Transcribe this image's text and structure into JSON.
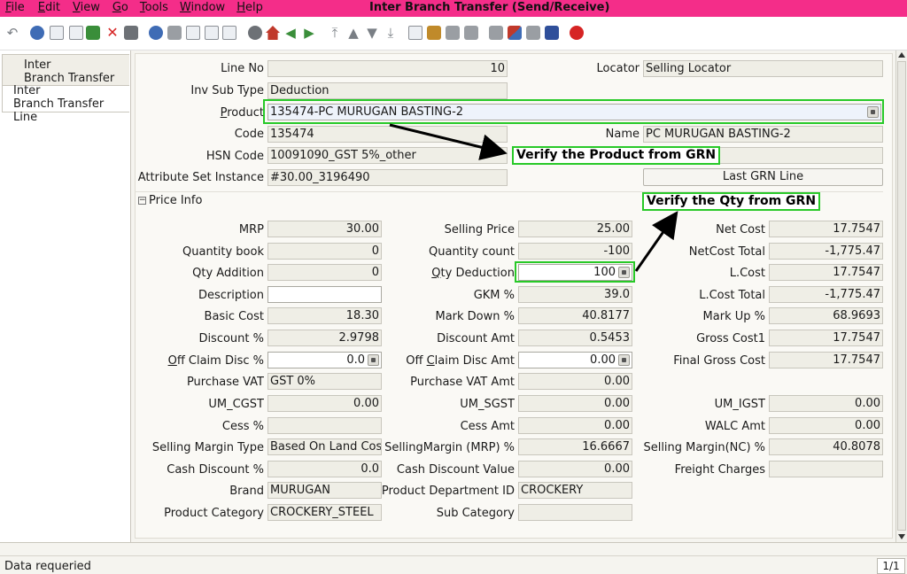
{
  "window": {
    "title": "Inter Branch Transfer (Send/Receive)"
  },
  "menu": [
    {
      "u": "F",
      "rest": "ile"
    },
    {
      "u": "E",
      "rest": "dit"
    },
    {
      "u": "V",
      "rest": "iew"
    },
    {
      "u": "G",
      "rest": "o"
    },
    {
      "u": "T",
      "rest": "ools"
    },
    {
      "u": "W",
      "rest": "indow"
    },
    {
      "u": "H",
      "rest": "elp"
    }
  ],
  "nav": {
    "tab_header": "Inter\nBranch Transfer",
    "tab_header_l1": "Inter",
    "tab_header_l2": "Branch Transfer",
    "tab_line_l1": "Inter",
    "tab_line_l2": "Branch Transfer Line"
  },
  "form": {
    "line_no_label": "Line No",
    "line_no": "10",
    "locator_label": "Locator",
    "locator": "Selling Locator",
    "inv_sub_type_label": "Inv Sub Type",
    "inv_sub_type": "Deduction",
    "product_label_u": "P",
    "product_label_rest": "roduct",
    "product": "135474-PC MURUGAN BASTING-2",
    "code_label": "Code",
    "code": "135474",
    "name_label": "Name",
    "name": "PC MURUGAN BASTING-2",
    "hsn_label": "HSN Code",
    "hsn": "10091090_GST 5%_other",
    "attr_label": "Attribute Set Instance",
    "attr": "#30.00_3196490",
    "last_grn_button": "Last GRN Line",
    "section_price": "Price Info"
  },
  "annotations": {
    "verify_product": "Verify the Product from GRN",
    "verify_qty": "Verify the Qty from GRN"
  },
  "price": {
    "mrp_label": "MRP",
    "mrp": "30.00",
    "selling_price_label": "Selling Price",
    "selling_price": "25.00",
    "net_cost_label": "Net Cost",
    "net_cost": "17.7547",
    "qty_book_label": "Quantity book",
    "qty_book": "0",
    "qty_count_label": "Quantity count",
    "qty_count": "-100",
    "netcost_total_label": "NetCost Total",
    "netcost_total": "-1,775.47",
    "qty_add_label": "Qty Addition",
    "qty_add": "0",
    "qty_ded_label_u": "Q",
    "qty_ded_label_rest": "ty Deduction",
    "qty_ded": "100",
    "lcost_label": "L.Cost",
    "lcost": "17.7547",
    "desc_label": "Description",
    "desc": "",
    "gkm_label": "GKM %",
    "gkm": "39.0",
    "lcost_total_label": "L.Cost Total",
    "lcost_total": "-1,775.47",
    "basic_cost_label": "Basic Cost",
    "basic_cost": "18.30",
    "markdown_label": "Mark Down %",
    "markdown": "40.8177",
    "markup_label": "Mark Up %",
    "markup": "68.9693",
    "discount_label": "Discount %",
    "discount": "2.9798",
    "discount_amt_label": "Discount Amt",
    "discount_amt": "0.5453",
    "gross_cost1_label": "Gross Cost1",
    "gross_cost1": "17.7547",
    "off_claim_pct_label_u": "O",
    "off_claim_pct_label_rest": "ff Claim Disc %",
    "off_claim_pct": "0.0",
    "off_claim_amt_label_a": "Off ",
    "off_claim_amt_label_u": "C",
    "off_claim_amt_label_rest": "laim Disc Amt",
    "off_claim_amt": "0.00",
    "final_gross_label": "Final Gross Cost",
    "final_gross": "17.7547",
    "purchase_vat_label": "Purchase VAT",
    "purchase_vat": "GST 0%",
    "purchase_vat_amt_label": "Purchase VAT Amt",
    "purchase_vat_amt": "0.00",
    "um_cgst_label": "UM_CGST",
    "um_cgst": "0.00",
    "um_sgst_label": "UM_SGST",
    "um_sgst": "0.00",
    "um_igst_label": "UM_IGST",
    "um_igst": "0.00",
    "cess_pct_label": "Cess %",
    "cess_pct": "",
    "cess_amt_label": "Cess Amt",
    "cess_amt": "0.00",
    "walc_amt_label": "WALC Amt",
    "walc_amt": "0.00",
    "sm_type_label": "Selling Margin Type",
    "sm_type": "Based On Land Cost",
    "sm_mrp_label": "SellingMargin (MRP) %",
    "sm_mrp": "16.6667",
    "sm_nc_label": "Selling Margin(NC) %",
    "sm_nc": "40.8078",
    "cash_disc_label": "Cash Discount %",
    "cash_disc": "0.0",
    "cash_disc_val_label": "Cash Discount Value",
    "cash_disc_val": "0.00",
    "freight_label": "Freight Charges",
    "freight": "",
    "brand_label": "Brand",
    "brand": "MURUGAN",
    "dept_label": "Product Department ID",
    "dept": "CROCKERY",
    "category_label": "Product Category",
    "category": "CROCKERY_STEEL",
    "subcat_label": "Sub Category",
    "subcat": ""
  },
  "status": {
    "message": "Data requeried",
    "page": "1/1"
  },
  "colors": {
    "titlebar": "#f42d89",
    "highlight": "#28c928"
  }
}
